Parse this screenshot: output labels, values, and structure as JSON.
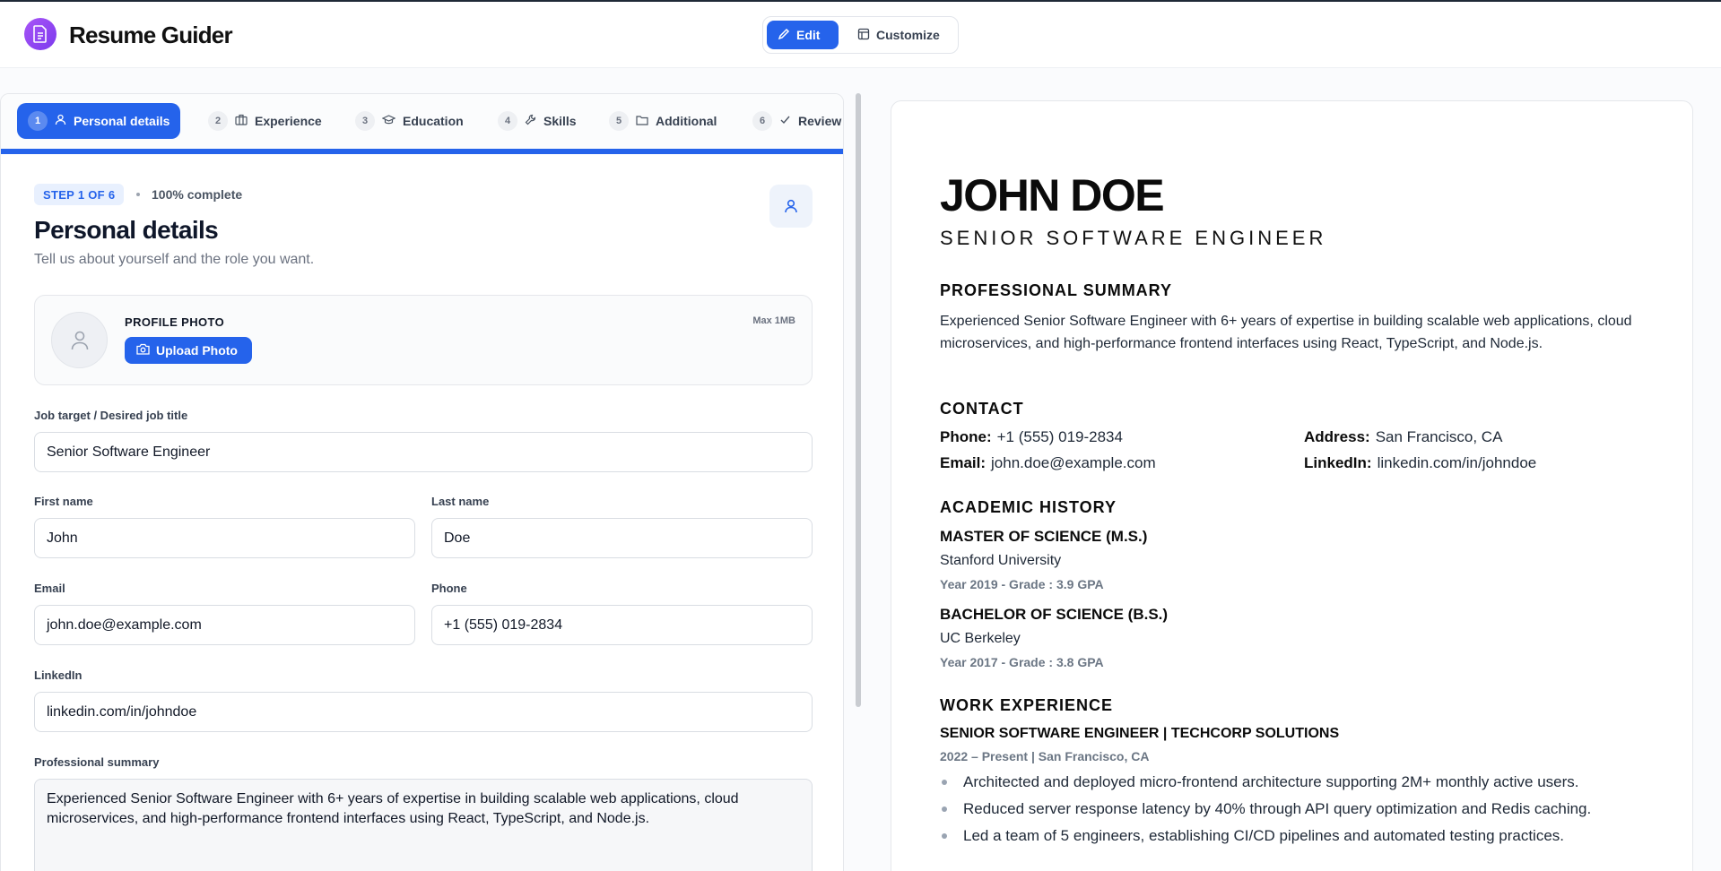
{
  "header": {
    "brand": "Resume Guider",
    "modes": [
      {
        "label": "Edit",
        "icon": "pencil-icon",
        "active": true
      },
      {
        "label": "Customize",
        "icon": "layout-icon",
        "active": false
      }
    ]
  },
  "tabs": [
    {
      "num": "1",
      "label": "Personal details",
      "icon": "user-icon",
      "active": true
    },
    {
      "num": "2",
      "label": "Experience",
      "icon": "briefcase-icon"
    },
    {
      "num": "3",
      "label": "Education",
      "icon": "graduation-cap-icon"
    },
    {
      "num": "4",
      "label": "Skills",
      "icon": "wrench-icon"
    },
    {
      "num": "5",
      "label": "Additional",
      "icon": "folder-icon"
    },
    {
      "num": "6",
      "label": "Review",
      "icon": "check-icon"
    }
  ],
  "progress_fraction": 1.0,
  "step": {
    "badge": "STEP 1 OF 6",
    "complete": "100% complete",
    "title": "Personal details",
    "subtitle": "Tell us about yourself and the role you want."
  },
  "photo": {
    "label": "PROFILE PHOTO",
    "button": "Upload Photo",
    "max": "Max 1MB"
  },
  "form": {
    "job_target_label": "Job target / Desired job title",
    "job_target": "Senior Software Engineer",
    "first_name_label": "First name",
    "first_name": "John",
    "last_name_label": "Last name",
    "last_name": "Doe",
    "email_label": "Email",
    "email": "john.doe@example.com",
    "phone_label": "Phone",
    "phone": "+1 (555) 019-2834",
    "linkedin_label": "LinkedIn",
    "linkedin": "linkedin.com/in/johndoe",
    "summary_label": "Professional summary",
    "summary": "Experienced Senior Software Engineer with 6+ years of expertise in building scalable web applications, cloud microservices, and high-performance frontend interfaces using React, TypeScript, and Node.js."
  },
  "resume": {
    "name": "JOHN DOE",
    "title": "SENIOR SOFTWARE ENGINEER",
    "summary_heading": "PROFESSIONAL SUMMARY",
    "summary": "Experienced Senior Software Engineer with 6+ years of expertise in building scalable web applications, cloud microservices, and high-performance frontend interfaces using React, TypeScript, and Node.js.",
    "contact_heading": "CONTACT",
    "contact": {
      "phone_label": "Phone:",
      "phone": "+1 (555) 019-2834",
      "address_label": "Address:",
      "address": "San Francisco, CA",
      "email_label": "Email:",
      "email": "john.doe@example.com",
      "linkedin_label": "LinkedIn:",
      "linkedin": "linkedin.com/in/johndoe"
    },
    "academic_heading": "ACADEMIC HISTORY",
    "education": [
      {
        "degree": "MASTER OF SCIENCE (M.S.)",
        "school": "Stanford University",
        "meta": "Year 2019 - Grade : 3.9 GPA"
      },
      {
        "degree": "BACHELOR OF SCIENCE (B.S.)",
        "school": "UC Berkeley",
        "meta": "Year 2017 - Grade : 3.8 GPA"
      }
    ],
    "work_heading": "WORK EXPERIENCE",
    "job": {
      "title": "SENIOR SOFTWARE ENGINEER | TECHCORP SOLUTIONS",
      "meta": "2022 – Present | San Francisco, CA",
      "bullets": [
        "Architected and deployed micro-frontend architecture supporting 2M+ monthly active users.",
        "Reduced server response latency by 40% through API query optimization and Redis caching.",
        "Led a team of 5 engineers, establishing CI/CD pipelines and automated testing practices."
      ]
    }
  },
  "colors": {
    "accent": "#2563eb",
    "brand_purple": "#8b5cf6"
  }
}
